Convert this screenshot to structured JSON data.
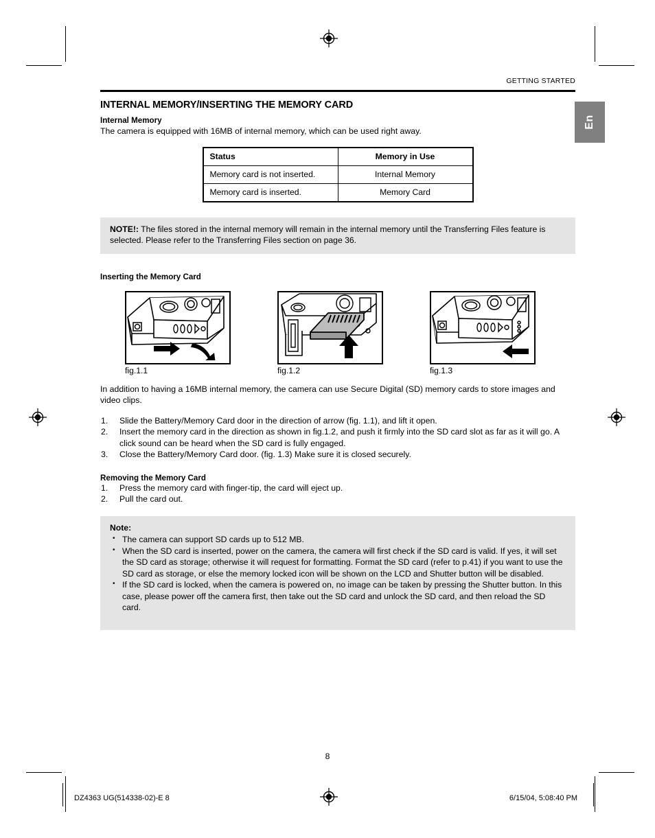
{
  "header": {
    "running_head": "GETTING STARTED",
    "language_tab": "En"
  },
  "section": {
    "title": "INTERNAL MEMORY/INSERTING THE MEMORY CARD",
    "internal_memory_heading": "Internal Memory",
    "internal_memory_text": "The camera is equipped with 16MB of internal memory, which can be used right away."
  },
  "status_table": {
    "columns": [
      "Status",
      "Memory in Use"
    ],
    "rows": [
      [
        "Memory card is not inserted.",
        "Internal Memory"
      ],
      [
        "Memory card is inserted.",
        "Memory Card"
      ]
    ]
  },
  "note_top": {
    "label": "NOTE!:",
    "text": " The files stored in the internal memory will remain in the internal memory until the Transferring Files feature is selected.  Please refer to the Transferring Files section on page 36."
  },
  "inserting": {
    "heading": "Inserting the Memory Card",
    "figures": [
      {
        "caption": "fig.1.1",
        "alt": "camera-battery-door-slide"
      },
      {
        "caption": "fig.1.2",
        "alt": "sd-card-insert"
      },
      {
        "caption": "fig.1.3",
        "alt": "camera-door-close"
      }
    ],
    "intro": "In addition to having a 16MB internal memory, the camera can use Secure Digital (SD) memory cards to store images and video clips.",
    "steps": [
      {
        "num": "1.",
        "text": "Slide the Battery/Memory Card door in the direction of arrow (fig. 1.1), and lift it open."
      },
      {
        "num": "2.",
        "text": "Insert the memory card in the direction as shown in fig.1.2, and push it firmly into the SD card slot as far as it will go. A click sound can be heard when the SD card is fully engaged."
      },
      {
        "num": "3.",
        "text": "Close the Battery/Memory Card door. (fig. 1.3) Make sure it is closed securely."
      }
    ]
  },
  "removing": {
    "heading": "Removing the Memory Card",
    "steps": [
      {
        "num": "1.",
        "text": "Press the memory card with finger-tip, the card will eject up."
      },
      {
        "num": "2.",
        "text": "Pull the card out."
      }
    ]
  },
  "note_bottom": {
    "heading": "Note:",
    "bullets": [
      "The camera can support SD cards up to 512 MB.",
      "When the SD card is inserted, power on the camera, the camera will first check if the SD card is valid. If yes, it will set the SD card as storage; otherwise it will request for formatting. Format the SD card (refer to p.41) if you want to use the SD card as storage, or else the memory locked icon will be shown on the LCD and Shutter button will be disabled.",
      "If the SD card is locked, when the camera is powered on, no image can be taken by pressing the Shutter button. In this case, please power off the camera first, then take out the SD card and unlock the SD card, and then reload the SD card."
    ]
  },
  "page_number": "8",
  "footer": {
    "left": "DZ4363 UG(514338-02)-E   8",
    "right": "6/15/04, 5:08:40 PM"
  },
  "colors": {
    "note_background": "#e4e4e4",
    "tab_background": "#808080",
    "rule": "#000000"
  }
}
